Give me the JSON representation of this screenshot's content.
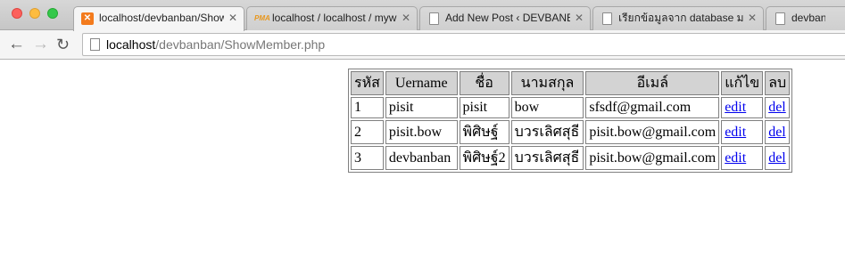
{
  "browser": {
    "tabs": [
      {
        "title": "localhost/devbanban/Show",
        "favicon": "xampp-icon",
        "active": true
      },
      {
        "title": "localhost / localhost / myw",
        "favicon": "phpmyadmin-icon",
        "active": false
      },
      {
        "title": "Add New Post ‹ DEVBANBA",
        "favicon": "page-icon",
        "active": false
      },
      {
        "title": "เรียกข้อมูลจาก database มาแ",
        "favicon": "page-icon",
        "active": false
      },
      {
        "title": "devbanban",
        "favicon": "page-icon",
        "active": false
      }
    ],
    "url_host": "localhost",
    "url_path": "/devbanban/ShowMember.php"
  },
  "table": {
    "headers": [
      "รหัส",
      "Uername",
      "ชื่อ",
      "นามสกุล",
      "อีเมล์",
      "แก้ไข",
      "ลบ"
    ],
    "rows": [
      [
        "1",
        "pisit",
        "pisit",
        "bow",
        "sfsdf@gmail.com",
        "edit",
        "del"
      ],
      [
        "2",
        "pisit.bow",
        "พิศิษฐ์",
        "บวรเลิศสุธี",
        "pisit.bow@gmail.com",
        "edit",
        "del"
      ],
      [
        "3",
        "devbanban",
        "พิศิษฐ์2",
        "บวรเลิศสุธี",
        "pisit.bow@gmail.com",
        "edit",
        "del"
      ]
    ]
  }
}
